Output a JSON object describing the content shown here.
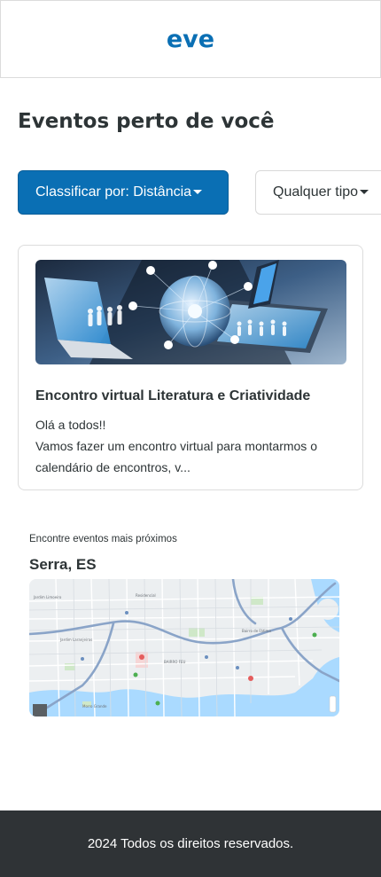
{
  "header": {
    "logo": "eve"
  },
  "main": {
    "title": "Eventos perto de você",
    "filters": {
      "sort_label": "Classificar por: Distância",
      "type_label": "Qualquer tipo"
    },
    "event": {
      "title": "Encontro virtual Literatura e Criatividade",
      "description_line1": "Olá a todos!!",
      "description_line2": "Vamos fazer um encontro virtual para montarmos o calendário de encontros, v..."
    },
    "nearby": {
      "label": "Encontre eventos mais próximos",
      "city": "Serra, ES"
    }
  },
  "footer": {
    "text": "2024 Todos os direitos reservados."
  },
  "colors": {
    "primary": "#0a6fb4",
    "text": "#2d3436",
    "footer_bg": "#2f3336",
    "map_water": "#aadaff"
  }
}
